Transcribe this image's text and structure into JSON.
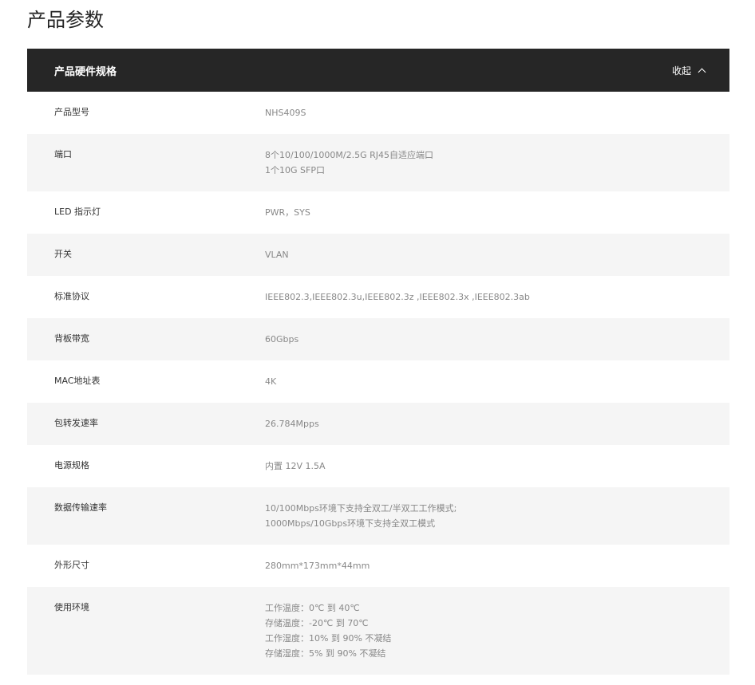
{
  "page_title": "产品参数",
  "panel": {
    "title": "产品硬件规格",
    "collapse_label": "收起"
  },
  "specs": [
    {
      "key": "产品型号",
      "lines": [
        "NHS409S"
      ]
    },
    {
      "key": "端口",
      "lines": [
        "8个10/100/1000M/2.5G  RJ45自适应端口",
        "1个10G SFP口"
      ]
    },
    {
      "key": "LED 指示灯",
      "lines": [
        "PWR，SYS"
      ]
    },
    {
      "key": "开关",
      "lines": [
        "VLAN"
      ]
    },
    {
      "key": "标准协议",
      "lines": [
        "IEEE802.3,IEEE802.3u,IEEE802.3z ,IEEE802.3x ,IEEE802.3ab"
      ]
    },
    {
      "key": "背板带宽",
      "lines": [
        "60Gbps"
      ]
    },
    {
      "key": "MAC地址表",
      "lines": [
        "4K"
      ]
    },
    {
      "key": "包转发速率",
      "lines": [
        "26.784Mpps"
      ]
    },
    {
      "key": "电源规格",
      "lines": [
        "内置 12V 1.5A"
      ]
    },
    {
      "key": "数据传输速率",
      "lines": [
        "10/100Mbps环境下支持全双工/半双工工作模式;",
        "1000Mbps/10Gbps环境下支持全双工模式"
      ]
    },
    {
      "key": "外形尺寸",
      "lines": [
        "280mm*173mm*44mm"
      ]
    },
    {
      "key": "使用环境",
      "lines": [
        "工作温度：0℃ 到 40℃",
        "存储温度：-20℃ 到 70℃",
        "工作湿度：10% 到 90% 不凝结",
        "存储湿度：5% 到 90% 不凝结"
      ]
    }
  ]
}
